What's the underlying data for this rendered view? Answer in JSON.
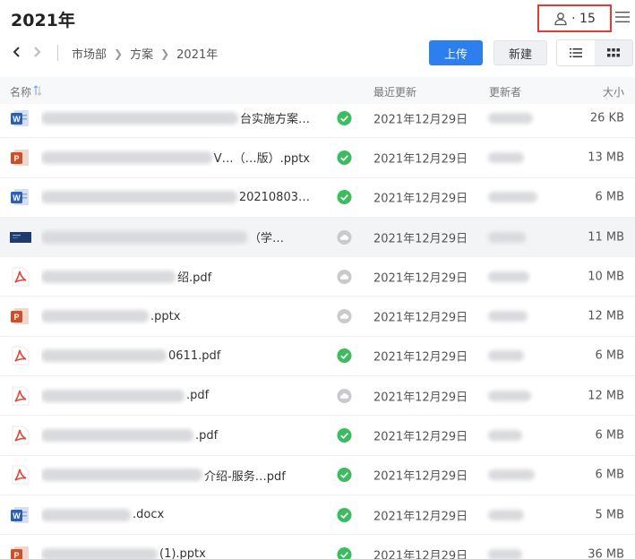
{
  "header": {
    "title": "2021年",
    "member_count_label": "· 15"
  },
  "breadcrumb": [
    "市场部",
    "方案",
    "2021年"
  ],
  "toolbar": {
    "upload_label": "上传",
    "new_label": "新建"
  },
  "columns": {
    "name": "名称",
    "modified": "最近更新",
    "updater": "更新者",
    "size": "大小"
  },
  "colors": {
    "accent": "#2d7ff0",
    "status_synced": "#3dbb61",
    "status_cloud": "#c8cacd",
    "ppt": "#d04f2a",
    "word": "#2b5fb8",
    "pdf": "#e2473a"
  },
  "files": [
    {
      "type": "word",
      "name_visible": "…台实施方案…",
      "status": "synced",
      "date": "2021年12月29日",
      "size": "26 KB"
    },
    {
      "type": "ppt",
      "name_visible": "V…（…版）.pptx",
      "status": "synced",
      "date": "2021年12月29日",
      "size": "13 MB"
    },
    {
      "type": "word",
      "name_visible": "…20210803…",
      "status": "synced",
      "date": "2021年12月29日",
      "size": "6 MB"
    },
    {
      "type": "image",
      "name_visible": "…（学…",
      "status": "cloud",
      "date": "2021年12月29日",
      "size": "11 MB"
    },
    {
      "type": "pdf",
      "name_visible": "…绍.pdf",
      "status": "cloud",
      "date": "2021年12月29日",
      "size": "10 MB"
    },
    {
      "type": "ppt",
      "name_visible": "….pptx",
      "status": "cloud",
      "date": "2021年12月29日",
      "size": "12 MB"
    },
    {
      "type": "pdf",
      "name_visible": "…0611.pdf",
      "status": "synced",
      "date": "2021年12月29日",
      "size": "6 MB"
    },
    {
      "type": "pdf",
      "name_visible": "….pdf",
      "status": "cloud",
      "date": "2021年12月29日",
      "size": "12 MB"
    },
    {
      "type": "pdf",
      "name_visible": "….pdf",
      "status": "synced",
      "date": "2021年12月29日",
      "size": "6 MB"
    },
    {
      "type": "pdf",
      "name_visible": "…介绍-服务…pdf",
      "status": "synced",
      "date": "2021年12月29日",
      "size": "6 MB"
    },
    {
      "type": "word",
      "name_visible": "….docx",
      "status": "synced",
      "date": "2021年12月29日",
      "size": "5 MB"
    },
    {
      "type": "ppt",
      "name_visible": "…(1).pptx",
      "status": "synced",
      "date": "2021年12月29日",
      "size": "36 MB"
    }
  ]
}
